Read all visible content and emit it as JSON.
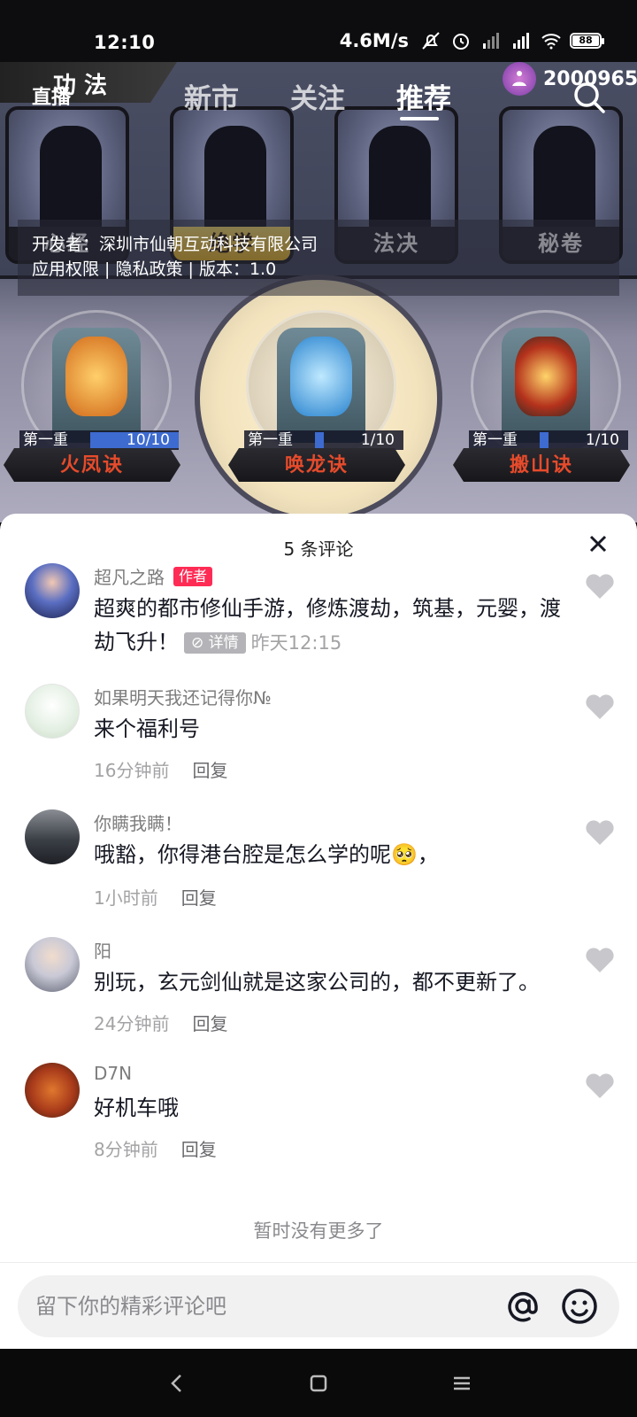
{
  "status_bar": {
    "time": "12:10",
    "net_speed": "4.6M/s",
    "battery": "88",
    "icons": [
      "mute-bell-icon",
      "alarm-icon",
      "hd-signal-icon",
      "hd-signal-icon",
      "wifi-icon",
      "battery-icon"
    ]
  },
  "top_nav": {
    "live_label": "直播",
    "tabs": [
      {
        "label": "新市",
        "active": false
      },
      {
        "label": "关注",
        "active": false
      },
      {
        "label": "推荐",
        "active": true
      }
    ],
    "coin_count": "2000965"
  },
  "game": {
    "banner_text": "功 法",
    "cards": [
      "心经",
      "绝学",
      "法决",
      "秘卷"
    ],
    "active_card": "绝学",
    "developer_line": "开发者：深圳市仙朝互动科技有限公司",
    "info_line": "应用权限 | 隐私政策 | 版本：1.0",
    "skills": [
      {
        "level": "第一重",
        "progress": "10/10",
        "name": "火凤诀"
      },
      {
        "level": "第一重",
        "progress": "1/10",
        "name": "唤龙诀"
      },
      {
        "level": "第一重",
        "progress": "1/10",
        "name": "搬山诀"
      }
    ]
  },
  "comments_panel": {
    "title": "5 条评论",
    "comments": [
      {
        "user": "超凡之路",
        "badge": "作者",
        "text": "超爽的都市修仙手游，修炼渡劫，筑基，元婴，渡劫飞升！",
        "detail_label": "详情",
        "time": "昨天12:15"
      },
      {
        "user": "如果明天我还记得你№",
        "text": "来个福利号",
        "time": "16分钟前",
        "reply_label": "回复"
      },
      {
        "user": "你瞒我瞒！",
        "text": "哦豁，你得港台腔是怎么学的呢🥺，",
        "time": "1小时前",
        "reply_label": "回复"
      },
      {
        "user": "阳",
        "text": "别玩，玄元剑仙就是这家公司的，都不更新了。",
        "time": "24分钟前",
        "reply_label": "回复"
      },
      {
        "user": "D7N",
        "text": "好机车哦",
        "time": "8分钟前",
        "reply_label": "回复"
      }
    ],
    "no_more": "暂时没有更多了",
    "input_placeholder": "留下你的精彩评论吧"
  },
  "colors": {
    "author_badge": "#fe2c55",
    "like_heart": "#c8c8cc",
    "sheet_bg": "#ffffff"
  }
}
